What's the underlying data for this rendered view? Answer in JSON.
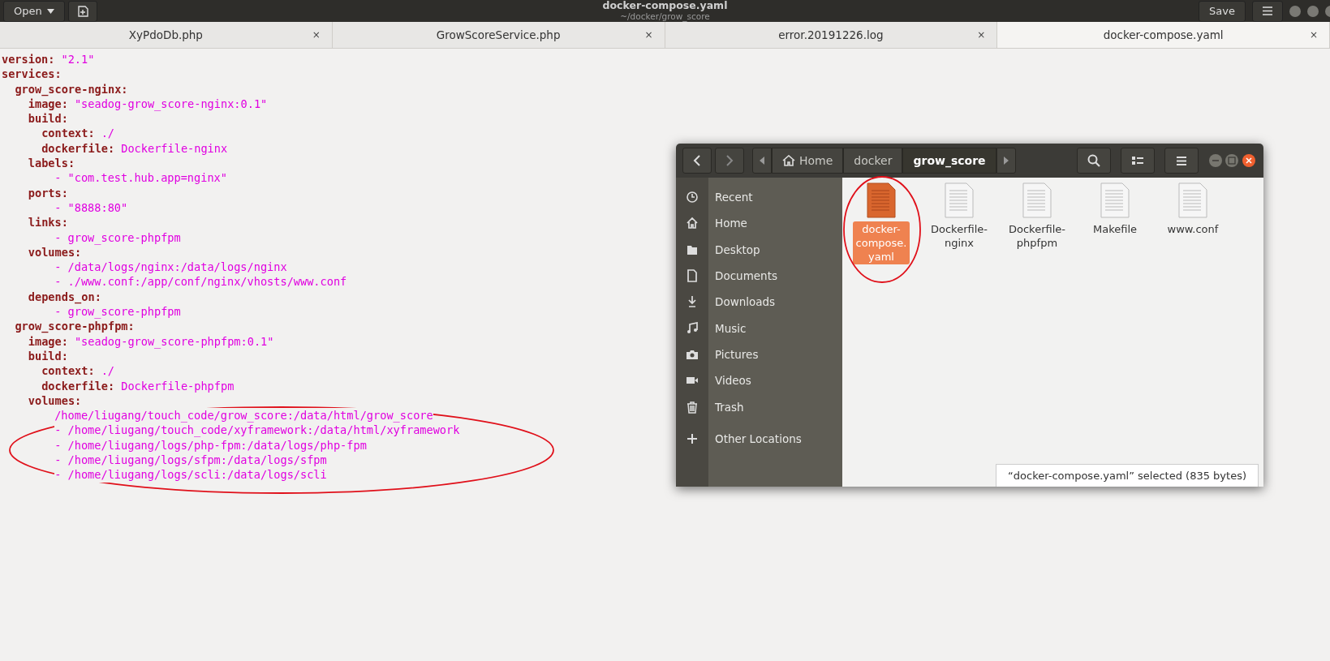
{
  "editor": {
    "open_button": "Open",
    "title": "docker-compose.yaml",
    "subtitle": "~/docker/grow_score",
    "save_button": "Save",
    "tabs": [
      {
        "label": "XyPdoDb.php",
        "close": "×",
        "selected": false
      },
      {
        "label": "GrowScoreService.php",
        "close": "×",
        "selected": false
      },
      {
        "label": "error.20191226.log",
        "close": "×",
        "selected": false
      },
      {
        "label": "docker-compose.yaml",
        "close": "×",
        "selected": true
      }
    ],
    "document": [
      {
        "key": "version:",
        "value": "\"2.1\""
      },
      {
        "key": "services:",
        "children": [
          {
            "key": "grow_score-nginx:",
            "children": [
              {
                "key": "image:",
                "value": "\"seadog-grow_score-nginx:0.1\""
              },
              {
                "key": "build:",
                "children": [
                  {
                    "key": "context:",
                    "value": "./"
                  },
                  {
                    "key": "dockerfile:",
                    "value": "Dockerfile-nginx"
                  }
                ]
              },
              {
                "key": "labels:",
                "items": [
                  "- \"com.test.hub.app=nginx\""
                ]
              },
              {
                "key": "ports:",
                "items": [
                  "- \"8888:80\""
                ]
              },
              {
                "key": "links:",
                "items": [
                  "- grow_score-phpfpm"
                ]
              },
              {
                "key": "volumes:",
                "items": [
                  "- /data/logs/nginx:/data/logs/nginx",
                  "- ./www.conf:/app/conf/nginx/vhosts/www.conf"
                ]
              },
              {
                "key": "depends_on:",
                "items": [
                  "- grow_score-phpfpm"
                ]
              }
            ]
          },
          {
            "key": "grow_score-phpfpm:",
            "children": [
              {
                "key": "image:",
                "value": "\"seadog-grow_score-phpfpm:0.1\""
              },
              {
                "key": "build:",
                "children": [
                  {
                    "key": "context:",
                    "value": "./"
                  },
                  {
                    "key": "dockerfile:",
                    "value": "Dockerfile-phpfpm"
                  }
                ]
              },
              {
                "key": "volumes:",
                "items": [
                  "/home/liugang/touch_code/grow_score:/data/html/grow_score",
                  "- /home/liugang/touch_code/xyframework:/data/html/xyframework",
                  "- /home/liugang/logs/php-fpm:/data/logs/php-fpm",
                  "- /home/liugang/logs/sfpm:/data/logs/sfpm",
                  "- /home/liugang/logs/scli:/data/logs/scli"
                ]
              }
            ]
          }
        ]
      }
    ]
  },
  "file_manager": {
    "path": [
      {
        "label": "Home",
        "selected": false
      },
      {
        "label": "docker",
        "selected": false
      },
      {
        "label": "grow_score",
        "selected": true
      }
    ],
    "sidebar": [
      {
        "label": "Recent"
      },
      {
        "label": "Home"
      },
      {
        "label": "Desktop"
      },
      {
        "label": "Documents"
      },
      {
        "label": "Downloads"
      },
      {
        "label": "Music"
      },
      {
        "label": "Pictures"
      },
      {
        "label": "Videos"
      },
      {
        "label": "Trash"
      },
      {
        "label": "Other Locations"
      }
    ],
    "files": [
      {
        "name_lines": [
          "docker-",
          "compose.",
          "yaml"
        ],
        "selected": true
      },
      {
        "name_lines": [
          "Dockerfile-",
          "nginx"
        ],
        "selected": false
      },
      {
        "name_lines": [
          "Dockerfile-",
          "phpfpm"
        ],
        "selected": false
      },
      {
        "name_lines": [
          "Makefile"
        ],
        "selected": false
      },
      {
        "name_lines": [
          "www.conf"
        ],
        "selected": false
      }
    ],
    "status": "“docker-compose.yaml” selected  (835 bytes)"
  }
}
